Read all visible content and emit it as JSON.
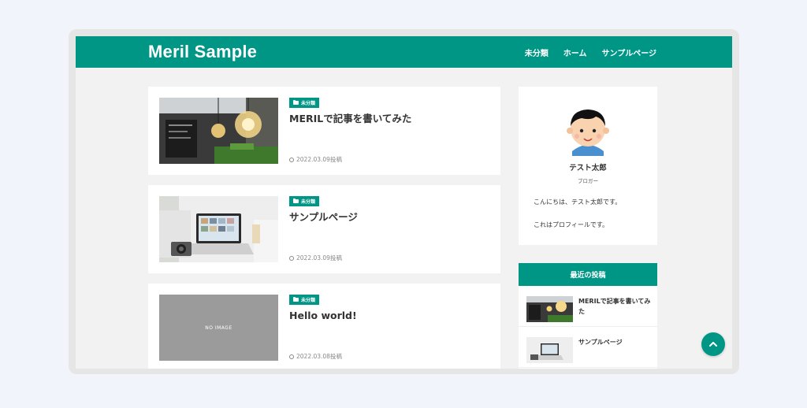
{
  "header": {
    "site_title": "Meril Sample",
    "nav": [
      "未分類",
      "ホーム",
      "サンプルページ"
    ]
  },
  "posts": [
    {
      "category": "未分類",
      "title": "MERILで記事を書いてみた",
      "date": "2022.03.09投稿",
      "thumb": "lightbulb-photo"
    },
    {
      "category": "未分類",
      "title": "サンプルページ",
      "date": "2022.03.09投稿",
      "thumb": "laptop-camera-photo"
    },
    {
      "category": "未分類",
      "title": "Hello world!",
      "date": "2022.03.08投稿",
      "thumb": "no-image",
      "thumb_text": "NO IMAGE"
    }
  ],
  "profile": {
    "name": "テスト太郎",
    "role": "ブロガー",
    "text1": "こんにちは、テスト太郎です。",
    "text2": "これはプロフィールです。"
  },
  "recent": {
    "heading": "最近の投稿",
    "items": [
      {
        "title": "MERILで記事を書いてみた"
      },
      {
        "title": "サンプルページ"
      }
    ]
  },
  "colors": {
    "accent": "#009685",
    "background": "#f2f2f2"
  },
  "icons": [
    "folder-icon",
    "clock-icon",
    "chevron-up-icon"
  ]
}
